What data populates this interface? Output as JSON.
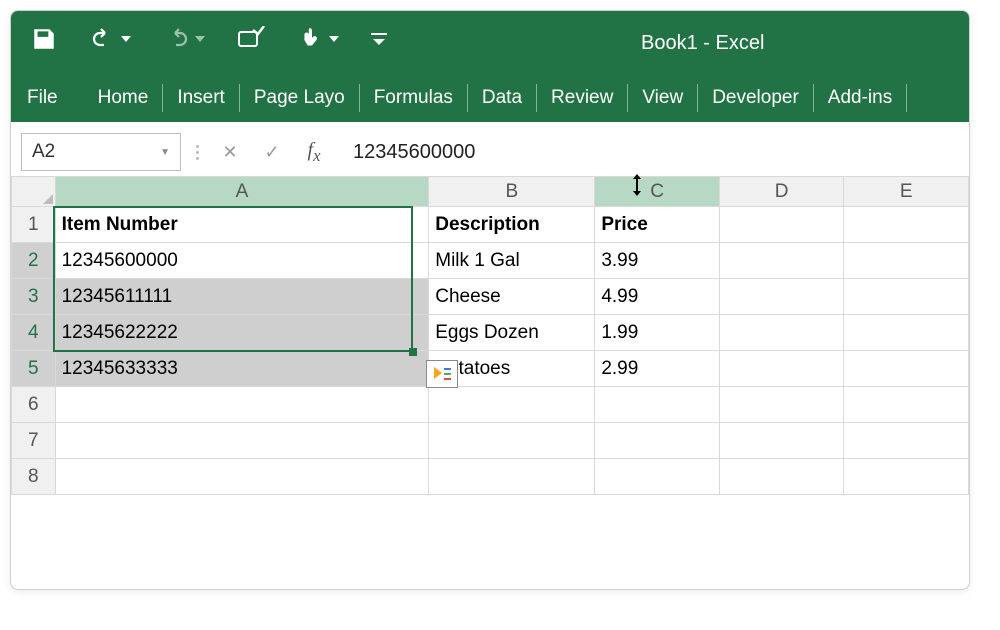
{
  "app": {
    "title": "Book1 - Excel"
  },
  "tabs": {
    "file": "File",
    "home": "Home",
    "insert": "Insert",
    "pagelayout": "Page Layo",
    "formulas": "Formulas",
    "data": "Data",
    "review": "Review",
    "view": "View",
    "developer": "Developer",
    "addins": "Add-ins"
  },
  "namebox": {
    "value": "A2"
  },
  "formula": {
    "value": "12345600000"
  },
  "columns": [
    "A",
    "B",
    "C",
    "D",
    "E"
  ],
  "headers": {
    "a": "Item Number",
    "b": "Description",
    "c": "Price"
  },
  "rows": [
    {
      "item": "12345600000",
      "desc": "Milk 1 Gal",
      "price": "3.99"
    },
    {
      "item": "12345611111",
      "desc": "Cheese",
      "price": "4.99"
    },
    {
      "item": "12345622222",
      "desc": "Eggs Dozen",
      "price": "1.99"
    },
    {
      "item": "12345633333",
      "desc": "Potatoes",
      "price": "2.99"
    }
  ],
  "selection": {
    "range": "A2:A5",
    "active": "A2"
  },
  "chart_data": {
    "type": "table",
    "columns": [
      "Item Number",
      "Description",
      "Price"
    ],
    "rows": [
      [
        12345600000,
        "Milk 1 Gal",
        3.99
      ],
      [
        12345611111,
        "Cheese",
        4.99
      ],
      [
        12345622222,
        "Eggs Dozen",
        1.99
      ],
      [
        12345633333,
        "Potatoes",
        2.99
      ]
    ]
  }
}
